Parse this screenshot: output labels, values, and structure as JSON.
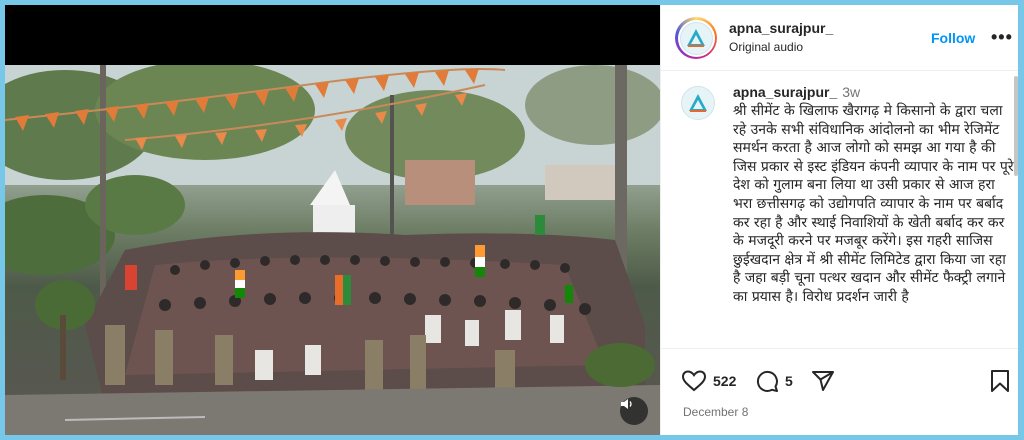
{
  "post": {
    "username": "apna_surajpur_",
    "audio": "Original audio",
    "follow_label": "Follow",
    "more_label": "•••"
  },
  "caption": {
    "username": "apna_surajpur_",
    "time": "3w",
    "text": "श्री सीमेंट के खिलाफ खैरागढ़ मे किसानो के द्वारा चला रहे उनके सभी संविधानिक आंदोलनो का भीम रेजिमेंट समर्थन करता है आज लोगो को समझ आ गया है की जिस प्रकार से इस्ट इंडियन कंपनी व्यापार के नाम पर पूरे देश को गुलाम बना लिया था उसी प्रकार से आज हरा भरा छत्तीसगढ़ को उद्योगपति व्यापार के नाम पर बर्बाद कर रहा है और स्थाई निवाशियों के खेती बर्बाद कर कर के मजदूरी करने पर मजबूर करेंगे। इस गहरी साजिस छुईखदान क्षेत्र में श्री सीमेंट लिमिटेड द्वारा किया जा रहा है जहा बड़ी चूना पत्थर खदान और सीमेंट फैक्ट्री लगाने का प्रयास है। विरोध प्रदर्शन जारी है"
  },
  "actions": {
    "likes": "522",
    "comments": "5",
    "date": "December 8"
  },
  "icons": {
    "like": "heart-icon",
    "comment": "comment-icon",
    "share": "share-icon",
    "save": "bookmark-icon",
    "mute": "speaker-icon"
  },
  "colors": {
    "follow": "#0095f6",
    "text": "#262626",
    "muted": "#737373",
    "page_bg": "#76c7e8"
  }
}
